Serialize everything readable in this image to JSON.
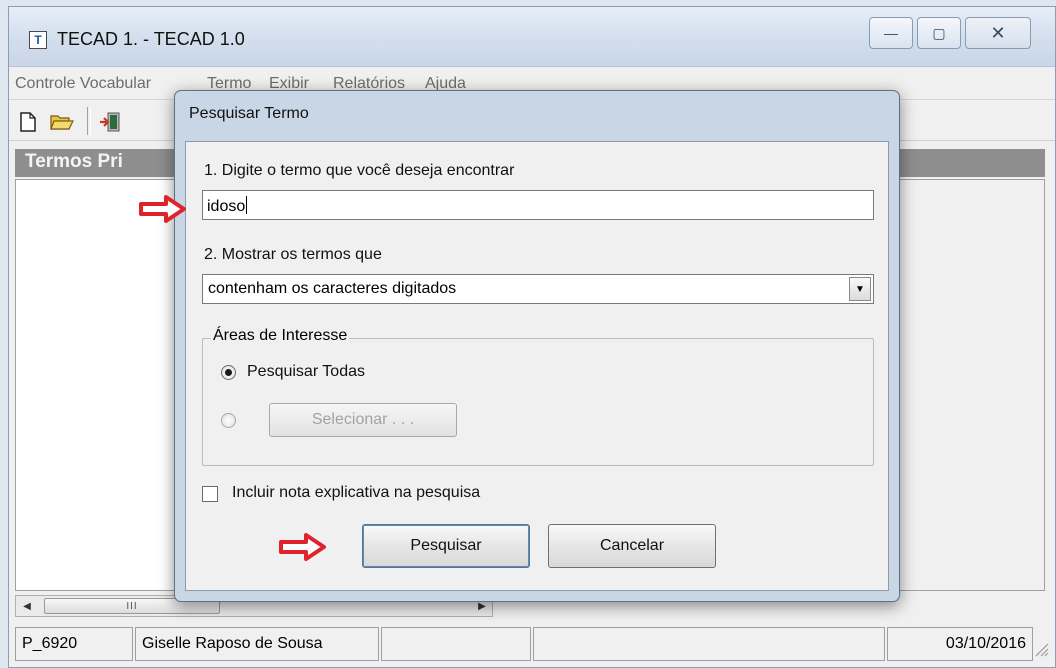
{
  "window": {
    "title": "TECAD 1.  -  TECAD 1.0",
    "icon_glyph": "T",
    "minimize_glyph": "—",
    "maximize_glyph": "▢",
    "close_glyph": "✕"
  },
  "menu": {
    "items": [
      "Controle Vocabular",
      "Termo",
      "Exibir",
      "Relatórios",
      "Ajuda"
    ]
  },
  "toolbar": {
    "icons": [
      "new-document-icon",
      "open-folder-icon",
      "exit-door-icon"
    ]
  },
  "terms_panel": {
    "header": "Termos Pri"
  },
  "scrollbar": {
    "left_glyph": "◀",
    "thumb_grip": "III",
    "right_glyph": "▶"
  },
  "status_bar": {
    "user_code": "P_6920",
    "user_name": "Giselle Raposo de Sousa",
    "cell_3": "",
    "cell_4": "",
    "date": "03/10/2016"
  },
  "dialog": {
    "title": "Pesquisar Termo",
    "step1_label": "1. Digite o termo que você deseja encontrar",
    "search_value": "idoso",
    "step2_label": "2. Mostrar os termos que",
    "show_option": "contenham os caracteres digitados",
    "select_arrow": "▼",
    "areas_legend": "Áreas de Interesse",
    "radio_all_label": "Pesquisar Todas",
    "select_button": "Selecionar . . .",
    "include_note_label": "Incluir nota explicativa na pesquisa",
    "search_button": "Pesquisar",
    "cancel_button": "Cancelar"
  },
  "colors": {
    "accent_arrow": "#e0232a",
    "panel_header": "#8e8e8e",
    "dialog_frame": "#c9d6e6"
  }
}
